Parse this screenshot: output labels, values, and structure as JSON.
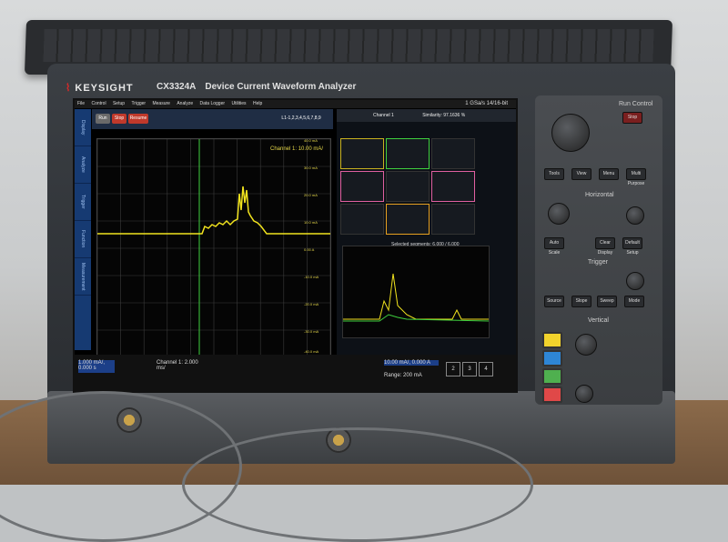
{
  "instrument": {
    "brand": "KEYSIGHT",
    "model": "CX3324A",
    "description": "Device Current Waveform Analyzer",
    "sample_rate": "1 GSa/s  14/16-bit"
  },
  "screen": {
    "menu": [
      "File",
      "Control",
      "Setup",
      "Trigger",
      "Measure",
      "Analyze",
      "Data Logger",
      "Utilities",
      "Help"
    ],
    "side_tabs": [
      "Display",
      "Analyze",
      "Trigger",
      "Function",
      "Measurement"
    ],
    "toolbar_buttons": [
      "Run",
      "Stop",
      "Resume"
    ],
    "channel_label": "Channel 1: 10.00 mA/",
    "trace_label": "L1-1,2,3,4,5,6,7,8,9",
    "right_header": "Channel 1",
    "similarity": "Similarity: 97.1636 %",
    "selected_segments": "Selected segments: 6,000 / 6,000",
    "y_ticks": [
      "40.0 mA",
      "30.0 mA",
      "20.0 mA",
      "10.0 mA",
      "0.00 A",
      "-10.0 mA",
      "-20.0 mA",
      "-30.0 mA",
      "-40.0 mA"
    ],
    "status_left": "1.000 mA/, 0.000 s",
    "status_mid": "Channel 1: 2.000 ms/",
    "status_right": "10.00 mA/, 0.000 A",
    "range": "Range: 200 mA",
    "channel_buttons": [
      "2",
      "3",
      "4"
    ]
  },
  "panel": {
    "run_control": "Run Control",
    "stop": "Stop",
    "horizontal": "Horizontal",
    "trigger": "Trigger",
    "vertical": "Vertical",
    "buttons": [
      "Tools",
      "View",
      "Menu",
      "Multi Purpose",
      "Auto Scale",
      "Clear Display",
      "Default Setup",
      "Source",
      "Slope",
      "Sweep",
      "Mode"
    ],
    "channel_colors": [
      "#f2d32c",
      "#2e86d6",
      "#4fb04f",
      "#e04848"
    ]
  },
  "colors": {
    "trace_yellow": "#f2e41e",
    "trace_green": "#3fd13f",
    "grid": "#3c3c3c",
    "accent_blue": "#163a72"
  }
}
